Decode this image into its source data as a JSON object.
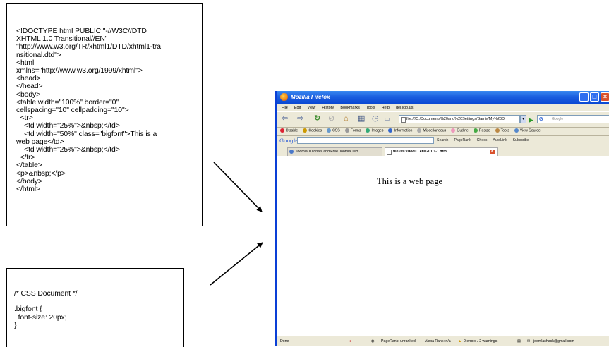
{
  "html_code": {
    "lines": [
      "<!DOCTYPE html PUBLIC \"-//W3C//DTD",
      "XHTML 1.0 Transitional//EN\"",
      "\"http://www.w3.org/TR/xhtml1/DTD/xhtml1-tra",
      "nsitional.dtd\">",
      "<html",
      "xmlns=\"http://www.w3.org/1999/xhtml\">",
      "<head>",
      "</head>",
      "<body>",
      "<table width=\"100%\" border=\"0\"",
      "cellspacing=\"10\" cellpadding=\"10\">",
      "  <tr>",
      "    <td width=\"25%\">&nbsp;</td>",
      "    <td width=\"50%\" class=\"bigfont\">This is a",
      "web page</td>",
      "    <td width=\"25%\">&nbsp;</td>",
      "  </tr>",
      "</table>",
      "<p>&nbsp;</p>",
      "</body>",
      "</html>"
    ]
  },
  "css_code": {
    "lines": [
      "/* CSS Document */",
      "",
      ".bigfont {",
      "  font-size: 20px;",
      "}"
    ]
  },
  "browser": {
    "window_title": "Mozilla Firefox",
    "menu": [
      "File",
      "Edit",
      "View",
      "History",
      "Bookmarks",
      "Tools",
      "Help",
      "del.icio.us"
    ],
    "url": "file:///C:/Documents%20and%20Settings/Barrie/My%20D",
    "search_placeholder": "Google",
    "webdev_toolbar": [
      "Disable",
      "Cookies",
      "CSS",
      "Forms",
      "Images",
      "Information",
      "Miscellaneous",
      "Outline",
      "Resize",
      "Tools",
      "View Source"
    ],
    "google_toolbar": {
      "logo": "Google",
      "items": [
        "Search",
        "PageRank",
        "Check",
        "AutoLink",
        "Subscribe"
      ]
    },
    "tabs": [
      {
        "label": "Joomla Tutorials and Free Joomla Tem..."
      },
      {
        "label": "file:///C:/Docu...er%201/1-1.html"
      }
    ],
    "page_text": "This is a web page",
    "status": {
      "left": "Done",
      "pagerank": "PageRank: unranked",
      "alexa": "Alexa Rank: n/a",
      "errors": "0 errors / 2 warnings",
      "email": "joomlashack@gmail.com"
    }
  }
}
